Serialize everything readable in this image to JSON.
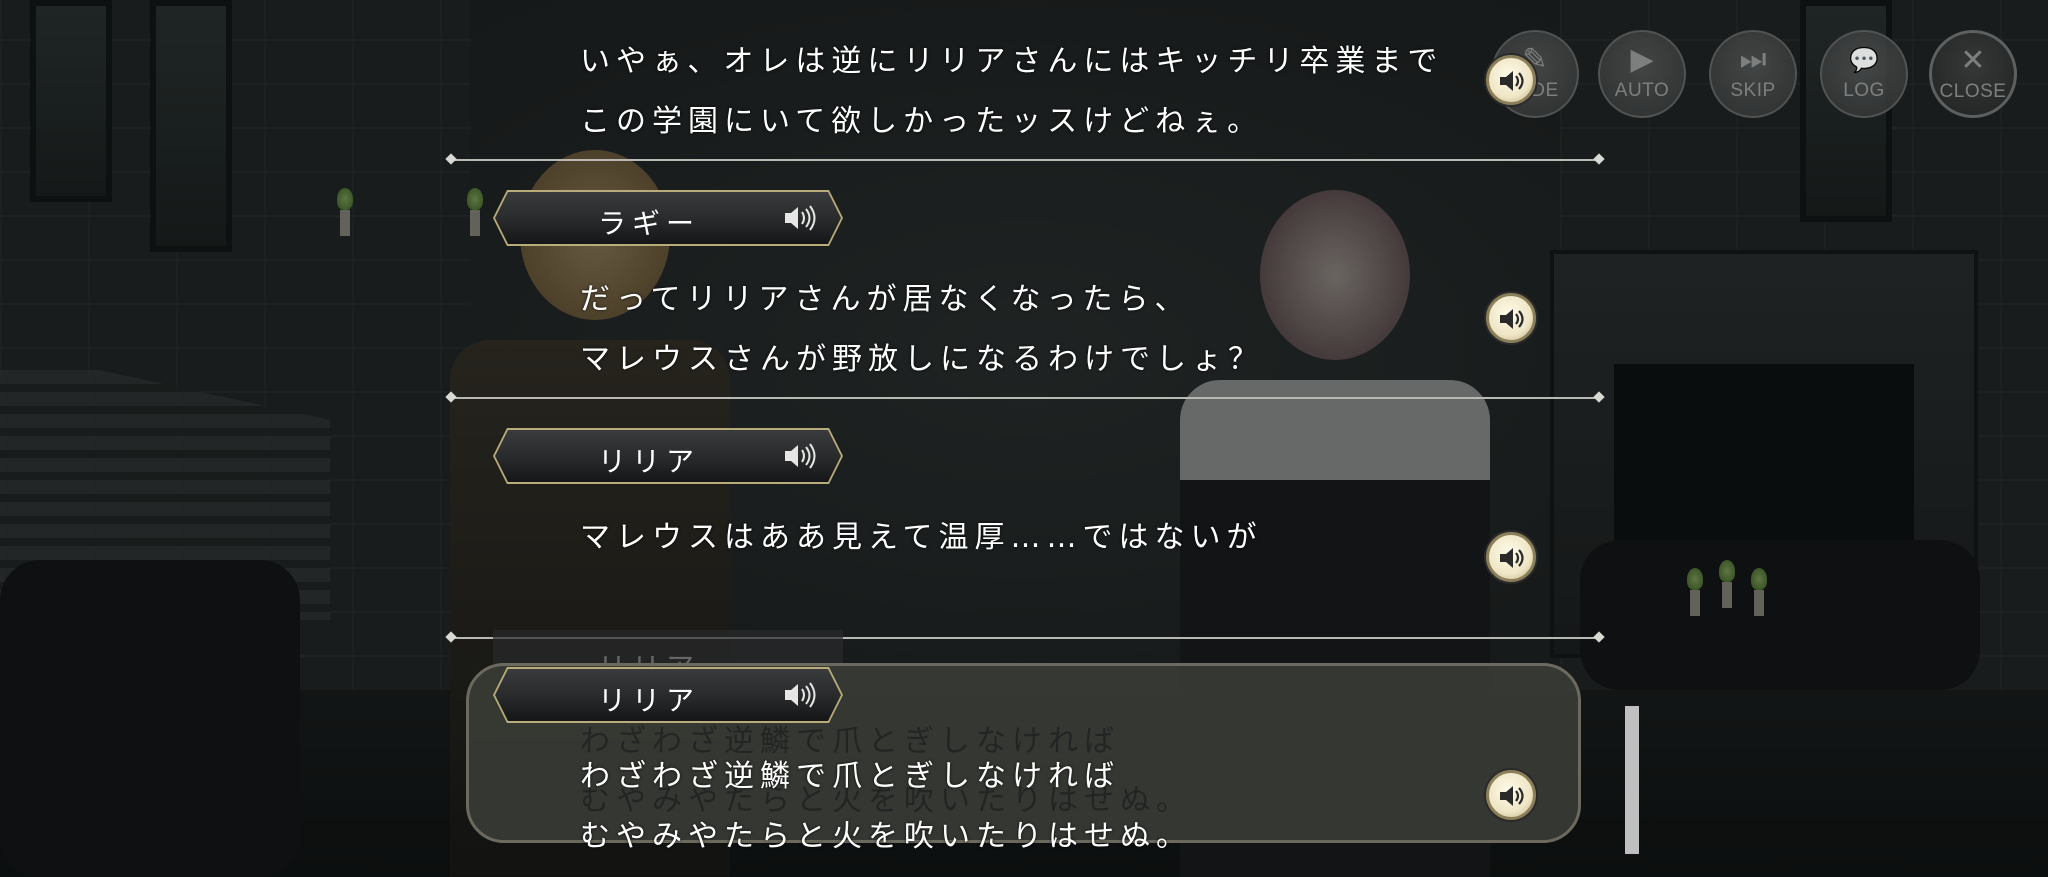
{
  "menu": [
    {
      "label": "HIDE",
      "icon": "hide-icon",
      "glyph": "✎"
    },
    {
      "label": "AUTO",
      "icon": "play-icon",
      "glyph": "▶"
    },
    {
      "label": "SKIP",
      "icon": "skip-icon",
      "glyph": "⏭"
    },
    {
      "label": "LOG",
      "icon": "log-icon",
      "glyph": "💬"
    },
    {
      "label": "CLOSE",
      "icon": "close-icon",
      "glyph": "✕"
    }
  ],
  "log": [
    {
      "speaker": "",
      "lines": [
        "いやぁ、オレは逆にリリアさんにはキッチリ卒業まで",
        "この学園にいて欲しかったッスけどねぇ。"
      ]
    },
    {
      "speaker": "ラギー",
      "lines": [
        "だってリリアさんが居なくなったら、",
        "マレウスさんが野放しになるわけでしょ？"
      ]
    },
    {
      "speaker": "リリア",
      "lines": [
        "マレウスはああ見えて温厚……ではないが"
      ]
    },
    {
      "speaker": "リリア",
      "lines": [
        "わざわざ逆鱗で爪とぎしなければ",
        "むやみやたらと火を吹いたりはせぬ。"
      ]
    }
  ],
  "colors": {
    "accent_gold": "#b8ac7a",
    "text": "#ffffff"
  }
}
